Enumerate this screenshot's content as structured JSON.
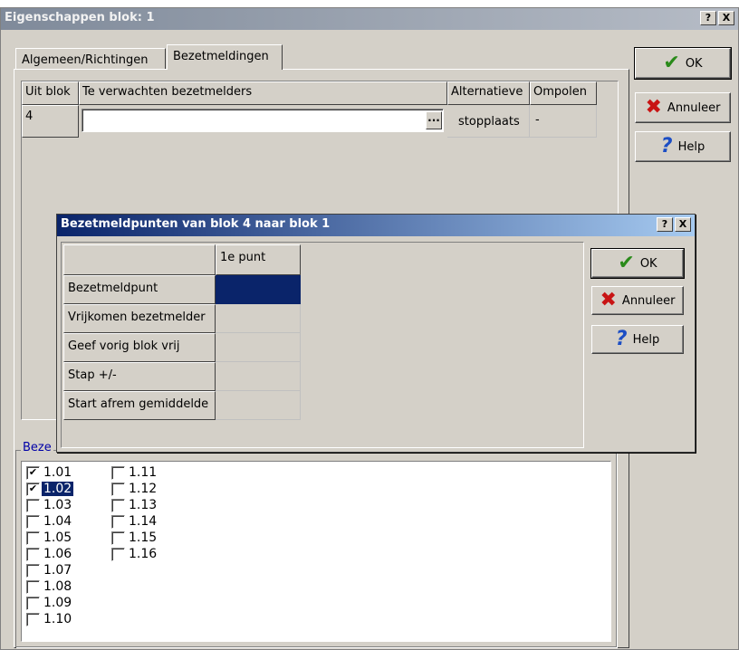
{
  "outer": {
    "title": "Eigenschappen blok: 1",
    "help_glyph": "?",
    "close_glyph": "X",
    "tabs": [
      {
        "label": "Algemeen/Richtingen"
      },
      {
        "label": "Bezetmeldingen"
      }
    ],
    "table": {
      "headers": [
        "Uit blok",
        "Te verwachten bezetmelders",
        "Alternatieve",
        "Ompolen"
      ],
      "rows": [
        {
          "uit_blok": "4",
          "bezetmelders": "",
          "ellipsis": "...",
          "alternatieve": "stopplaats",
          "ompolen": "-"
        }
      ]
    },
    "buttons": {
      "ok": "OK",
      "cancel": "Annuleer",
      "help": "Help"
    },
    "group_label": "Beze",
    "checkboxes_col1": [
      {
        "label": "1.01",
        "checked": true
      },
      {
        "label": "1.02",
        "checked": true
      },
      {
        "label": "1.03",
        "checked": false
      },
      {
        "label": "1.04",
        "checked": false
      },
      {
        "label": "1.05",
        "checked": false
      },
      {
        "label": "1.06",
        "checked": false
      },
      {
        "label": "1.07",
        "checked": false
      },
      {
        "label": "1.08",
        "checked": false
      },
      {
        "label": "1.09",
        "checked": false
      },
      {
        "label": "1.10",
        "checked": false
      }
    ],
    "checkboxes_col2": [
      {
        "label": "1.11",
        "checked": false
      },
      {
        "label": "1.12",
        "checked": false
      },
      {
        "label": "1.13",
        "checked": false
      },
      {
        "label": "1.14",
        "checked": false
      },
      {
        "label": "1.15",
        "checked": false
      },
      {
        "label": "1.16",
        "checked": false
      }
    ],
    "selected_checkbox": "1.02"
  },
  "inner": {
    "title": "Bezetmeldpunten van blok 4 naar blok 1",
    "help_glyph": "?",
    "close_glyph": "X",
    "column_header": "1e punt",
    "rows": [
      "Bezetmeldpunt",
      "Vrijkomen bezetmelder",
      "Geef vorig blok vrij",
      "Stap +/-",
      "Start afrem gemiddelde"
    ],
    "buttons": {
      "ok": "OK",
      "cancel": "Annuleer",
      "help": "Help"
    }
  },
  "colors": {
    "face": "#d4d0c8",
    "titlebar_active": "#0a246a",
    "selection": "#0a246a"
  }
}
